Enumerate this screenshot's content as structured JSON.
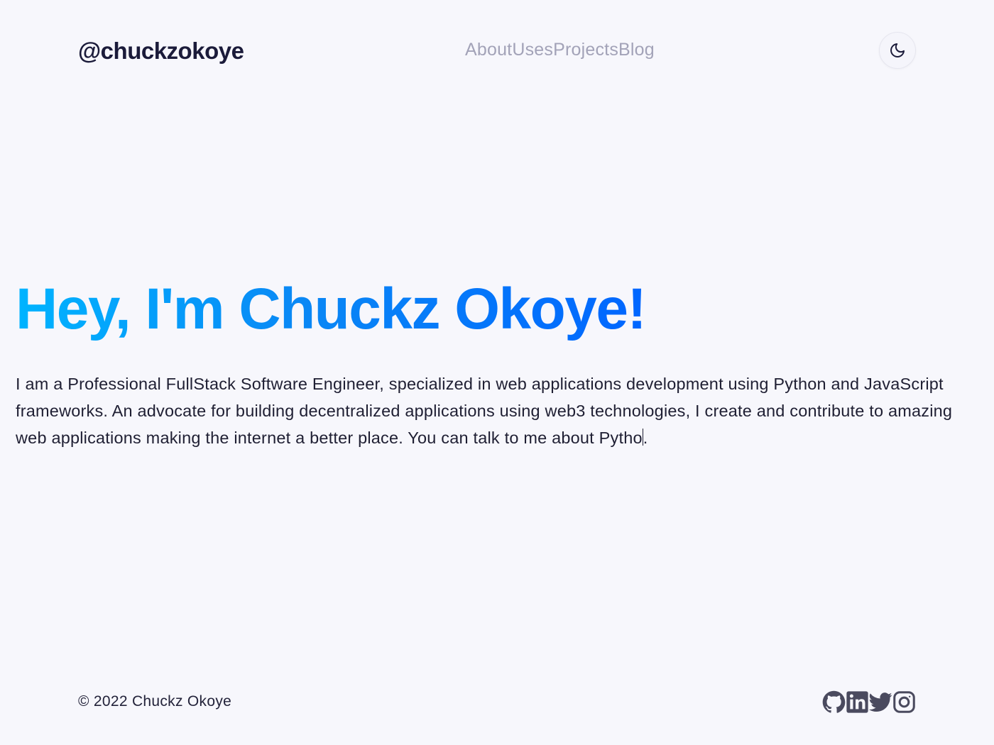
{
  "header": {
    "brand": "@chuckzokoye",
    "nav": [
      "About",
      "Uses",
      "Projects",
      "Blog"
    ],
    "theme_toggle_icon": "moon-icon"
  },
  "hero": {
    "title": "Hey, I'm Chuckz Okoye!",
    "intro": "I am a Professional FullStack Software Engineer, specialized in web applications development using Python and JavaScript frameworks. An advocate for building decentralized applications using web3 technologies, I create and contribute to amazing web applications making the internet a better place. You can talk to me about Pytho",
    "intro_end": ".",
    "gradient": [
      "#00b4ff",
      "#0066ff"
    ]
  },
  "footer": {
    "copyright": "© 2022 Chuckz Okoye",
    "socials": [
      "github-icon",
      "linkedin-icon",
      "twitter-icon",
      "instagram-icon"
    ],
    "icon_color": "#4a4a5e"
  }
}
